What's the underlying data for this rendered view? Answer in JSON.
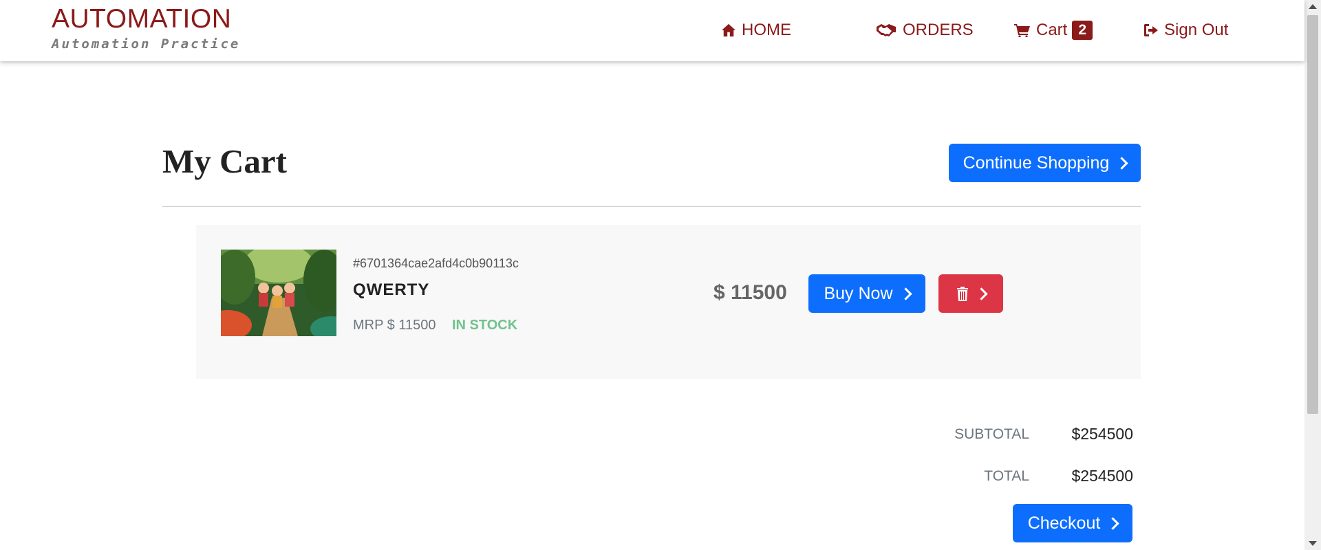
{
  "brand": {
    "title": "AUTOMATION",
    "subtitle": "Automation Practice"
  },
  "nav": {
    "home": "HOME",
    "orders": "ORDERS",
    "cart": "Cart",
    "cart_count": "2",
    "sign_out": "Sign Out"
  },
  "page": {
    "title": "My Cart",
    "continue_label": "Continue Shopping"
  },
  "item": {
    "id": "#6701364cae2afd4c0b90113c",
    "name": "QWERTY",
    "mrp": "MRP $ 11500",
    "stock": "IN STOCK",
    "price": "$ 11500",
    "buy_label": "Buy Now"
  },
  "totals": {
    "subtotal_label": "SUBTOTAL",
    "subtotal_value": "$254500",
    "total_label": "TOTAL",
    "total_value": "$254500",
    "checkout_label": "Checkout"
  },
  "colors": {
    "brand": "#8b1a1a",
    "primary": "#0d6efd",
    "danger": "#dc3545",
    "in_stock": "#6fc28c"
  },
  "icons": {
    "home": "home-icon",
    "orders": "handshake-icon",
    "cart": "shopping-cart-icon",
    "sign_out": "sign-out-icon",
    "delete": "trash-icon",
    "chevron": "chevron-right-icon"
  }
}
